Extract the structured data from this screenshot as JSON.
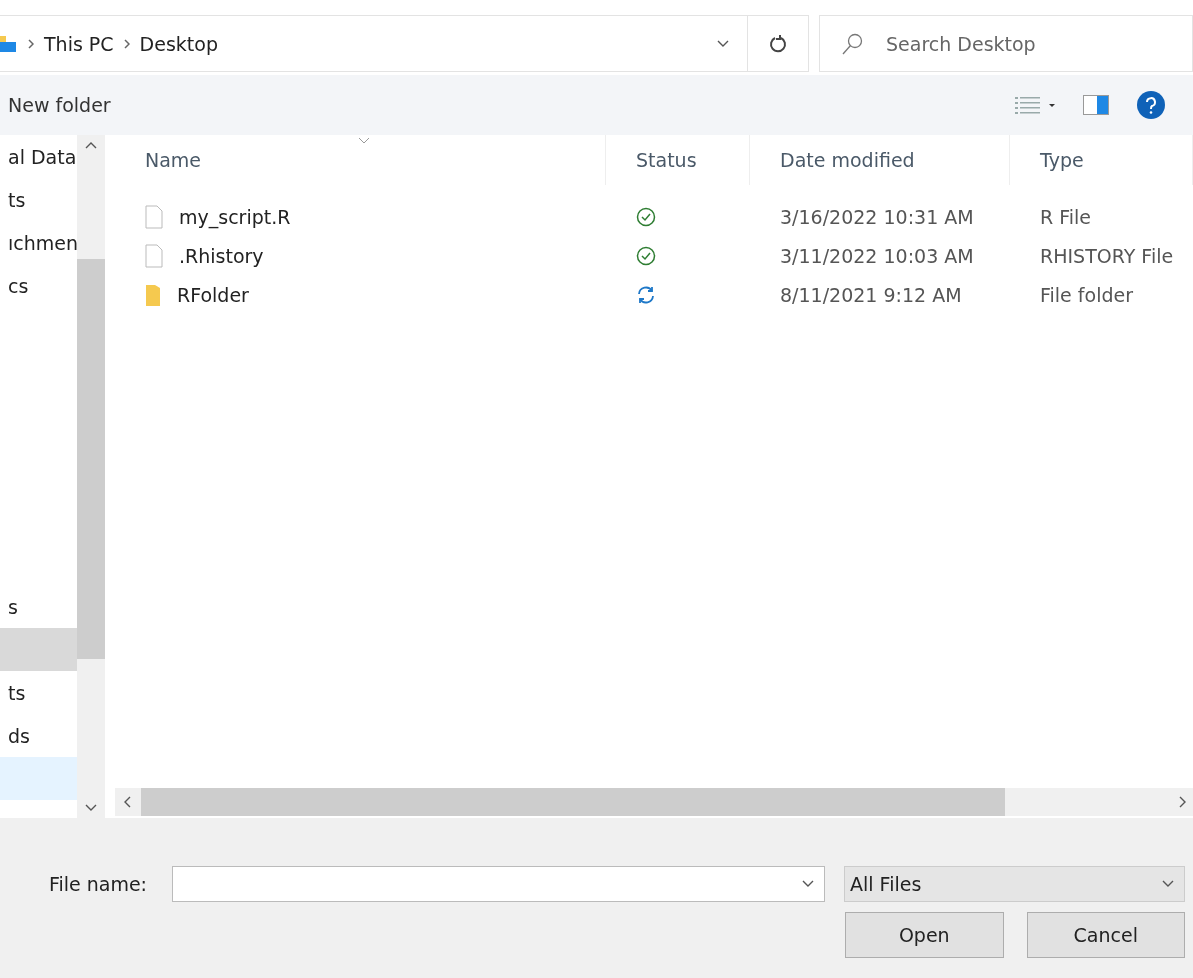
{
  "address_bar": {
    "breadcrumbs": [
      "This PC",
      "Desktop"
    ]
  },
  "search": {
    "placeholder": "Search Desktop"
  },
  "toolbar": {
    "new_folder": "New folder"
  },
  "sidebar": {
    "groups": [
      [
        {
          "label": "al Data",
          "selected": false,
          "highlighted": false
        },
        {
          "label": "ts",
          "selected": false,
          "highlighted": false
        },
        {
          "label": "ıchmen",
          "selected": false,
          "highlighted": false
        },
        {
          "label": "cs",
          "selected": false,
          "highlighted": false
        }
      ],
      [
        {
          "label": "s",
          "selected": false,
          "highlighted": false
        },
        {
          "selected": true,
          "highlighted": false
        },
        {
          "label": "ts",
          "selected": false,
          "highlighted": false
        },
        {
          "label": "ds",
          "selected": false,
          "highlighted": false
        },
        {
          "selected": false,
          "highlighted": true
        }
      ]
    ]
  },
  "table": {
    "columns": [
      "Name",
      "Status",
      "Date modified",
      "Type"
    ],
    "rows": [
      {
        "kind": "file",
        "name": "my_script.R",
        "synced": true,
        "date": "3/16/2022 10:31 AM",
        "type": "R File"
      },
      {
        "kind": "file",
        "name": ".Rhistory",
        "synced": true,
        "date": "3/11/2022 10:03 AM",
        "type": "RHISTORY File"
      },
      {
        "kind": "folder",
        "name": "RFolder",
        "synced": false,
        "date": "8/11/2021 9:12 AM",
        "type": "File folder"
      }
    ]
  },
  "footer": {
    "file_name_label": "File name:",
    "filter": "All Files",
    "buttons": [
      "Open",
      "Cancel"
    ]
  }
}
